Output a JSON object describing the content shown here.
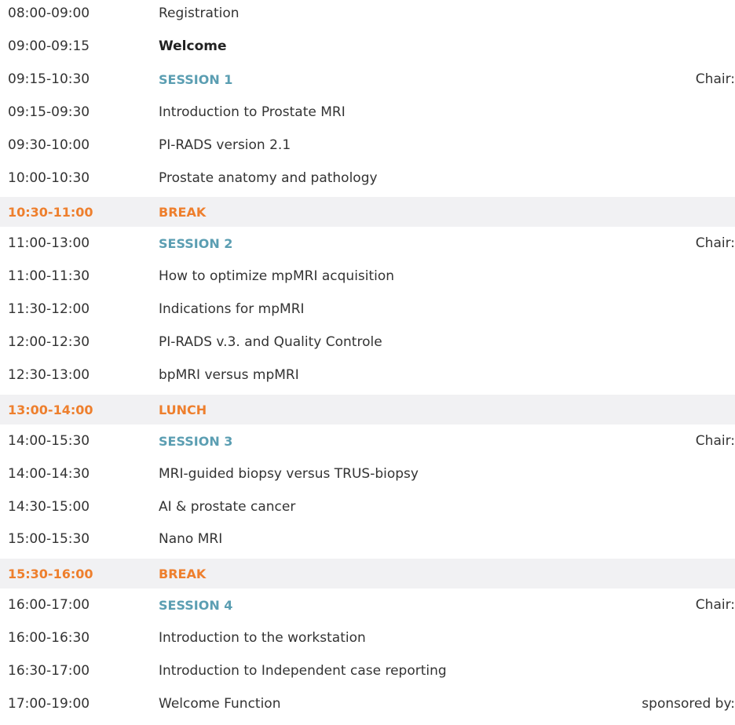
{
  "schedule": {
    "colors": {
      "session": "#5b9eb2",
      "break": "#ee7f2d",
      "break_bg": "#f1f1f3",
      "text": "#333333"
    },
    "rows": [
      {
        "time": "08:00-09:00",
        "title": "Registration",
        "kind": "item"
      },
      {
        "time": "09:00-09:15",
        "title": "Welcome",
        "kind": "bold"
      },
      {
        "time": "09:15-10:30",
        "title": "SESSION 1",
        "kind": "session",
        "right": "Chair:"
      },
      {
        "time": "09:15-09:30",
        "title": "Introduction to Prostate MRI",
        "kind": "item"
      },
      {
        "time": "09:30-10:00",
        "title": "PI-RADS version 2.1",
        "kind": "item"
      },
      {
        "time": "10:00-10:30",
        "title": "Prostate anatomy and pathology",
        "kind": "item"
      },
      {
        "time": "10:30-11:00",
        "title": "BREAK",
        "kind": "break"
      },
      {
        "time": "11:00-13:00",
        "title": "SESSION 2",
        "kind": "session",
        "right": "Chair:"
      },
      {
        "time": "11:00-11:30",
        "title": "How to optimize mpMRI acquisition",
        "kind": "item"
      },
      {
        "time": "11:30-12:00",
        "title": "Indications for mpMRI",
        "kind": "item"
      },
      {
        "time": "12:00-12:30",
        "title": "PI-RADS v.3. and Quality Controle",
        "kind": "item"
      },
      {
        "time": "12:30-13:00",
        "title": "bpMRI versus mpMRI",
        "kind": "item"
      },
      {
        "time": "13:00-14:00",
        "title": "LUNCH",
        "kind": "break"
      },
      {
        "time": "14:00-15:30",
        "title": "SESSION 3",
        "kind": "session",
        "right": "Chair:"
      },
      {
        "time": "14:00-14:30",
        "title": "MRI-guided biopsy versus TRUS-biopsy",
        "kind": "item"
      },
      {
        "time": "14:30-15:00",
        "title": "AI & prostate cancer",
        "kind": "item"
      },
      {
        "time": "15:00-15:30",
        "title": "Nano MRI",
        "kind": "item"
      },
      {
        "time": "15:30-16:00",
        "title": "BREAK",
        "kind": "break"
      },
      {
        "time": "16:00-17:00",
        "title": "SESSION 4",
        "kind": "session",
        "right": "Chair:"
      },
      {
        "time": "16:00-16:30",
        "title": "Introduction to the workstation",
        "kind": "item"
      },
      {
        "time": "16:30-17:00",
        "title": "Introduction to Independent case reporting",
        "kind": "item"
      },
      {
        "time": "17:00-19:00",
        "title": "Welcome Function",
        "kind": "item",
        "right": "sponsored by:"
      }
    ]
  }
}
